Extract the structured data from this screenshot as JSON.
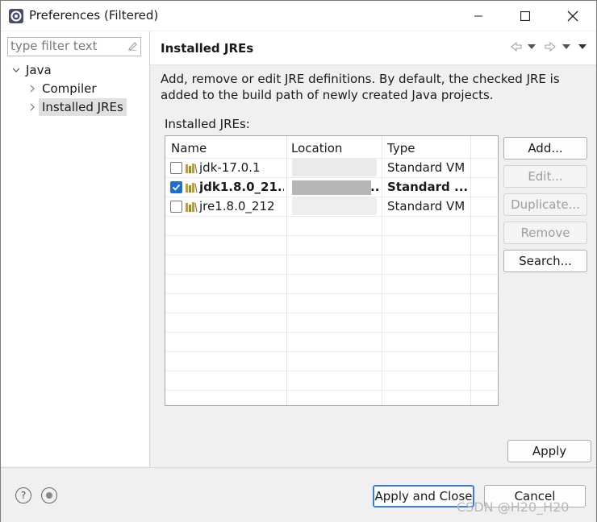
{
  "window": {
    "title": "Preferences (Filtered)"
  },
  "sidebar": {
    "filter_placeholder": "type filter text",
    "tree": [
      {
        "label": "Java",
        "expanded": true
      },
      {
        "label": "Compiler",
        "expanded": false
      },
      {
        "label": "Installed JREs",
        "expanded": false,
        "selected": true
      }
    ]
  },
  "page": {
    "title": "Installed JREs",
    "description": "Add, remove or edit JRE definitions. By default, the checked JRE is added to the build path of newly created Java projects.",
    "list_label": "Installed JREs:"
  },
  "jre_table": {
    "columns": [
      "Name",
      "Location",
      "Type"
    ],
    "rows": [
      {
        "checked": false,
        "name": "jdk-17.0.1",
        "location": "",
        "type": "Standard VM",
        "bold": false
      },
      {
        "checked": true,
        "name": "jdk1.8.0_21...",
        "location": "..",
        "type": "Standard ...",
        "bold": true
      },
      {
        "checked": false,
        "name": "jre1.8.0_212",
        "location": "",
        "type": "Standard VM",
        "bold": false
      }
    ]
  },
  "side_buttons": {
    "add": "Add...",
    "edit": "Edit...",
    "duplicate": "Duplicate...",
    "remove": "Remove",
    "search": "Search..."
  },
  "buttons": {
    "apply": "Apply",
    "apply_and_close": "Apply and Close",
    "cancel": "Cancel"
  },
  "watermark": "CSDN @H20_H20",
  "colors": {
    "checkbox_checked": "#1f6fd1",
    "selection": "#e0e0e0"
  }
}
